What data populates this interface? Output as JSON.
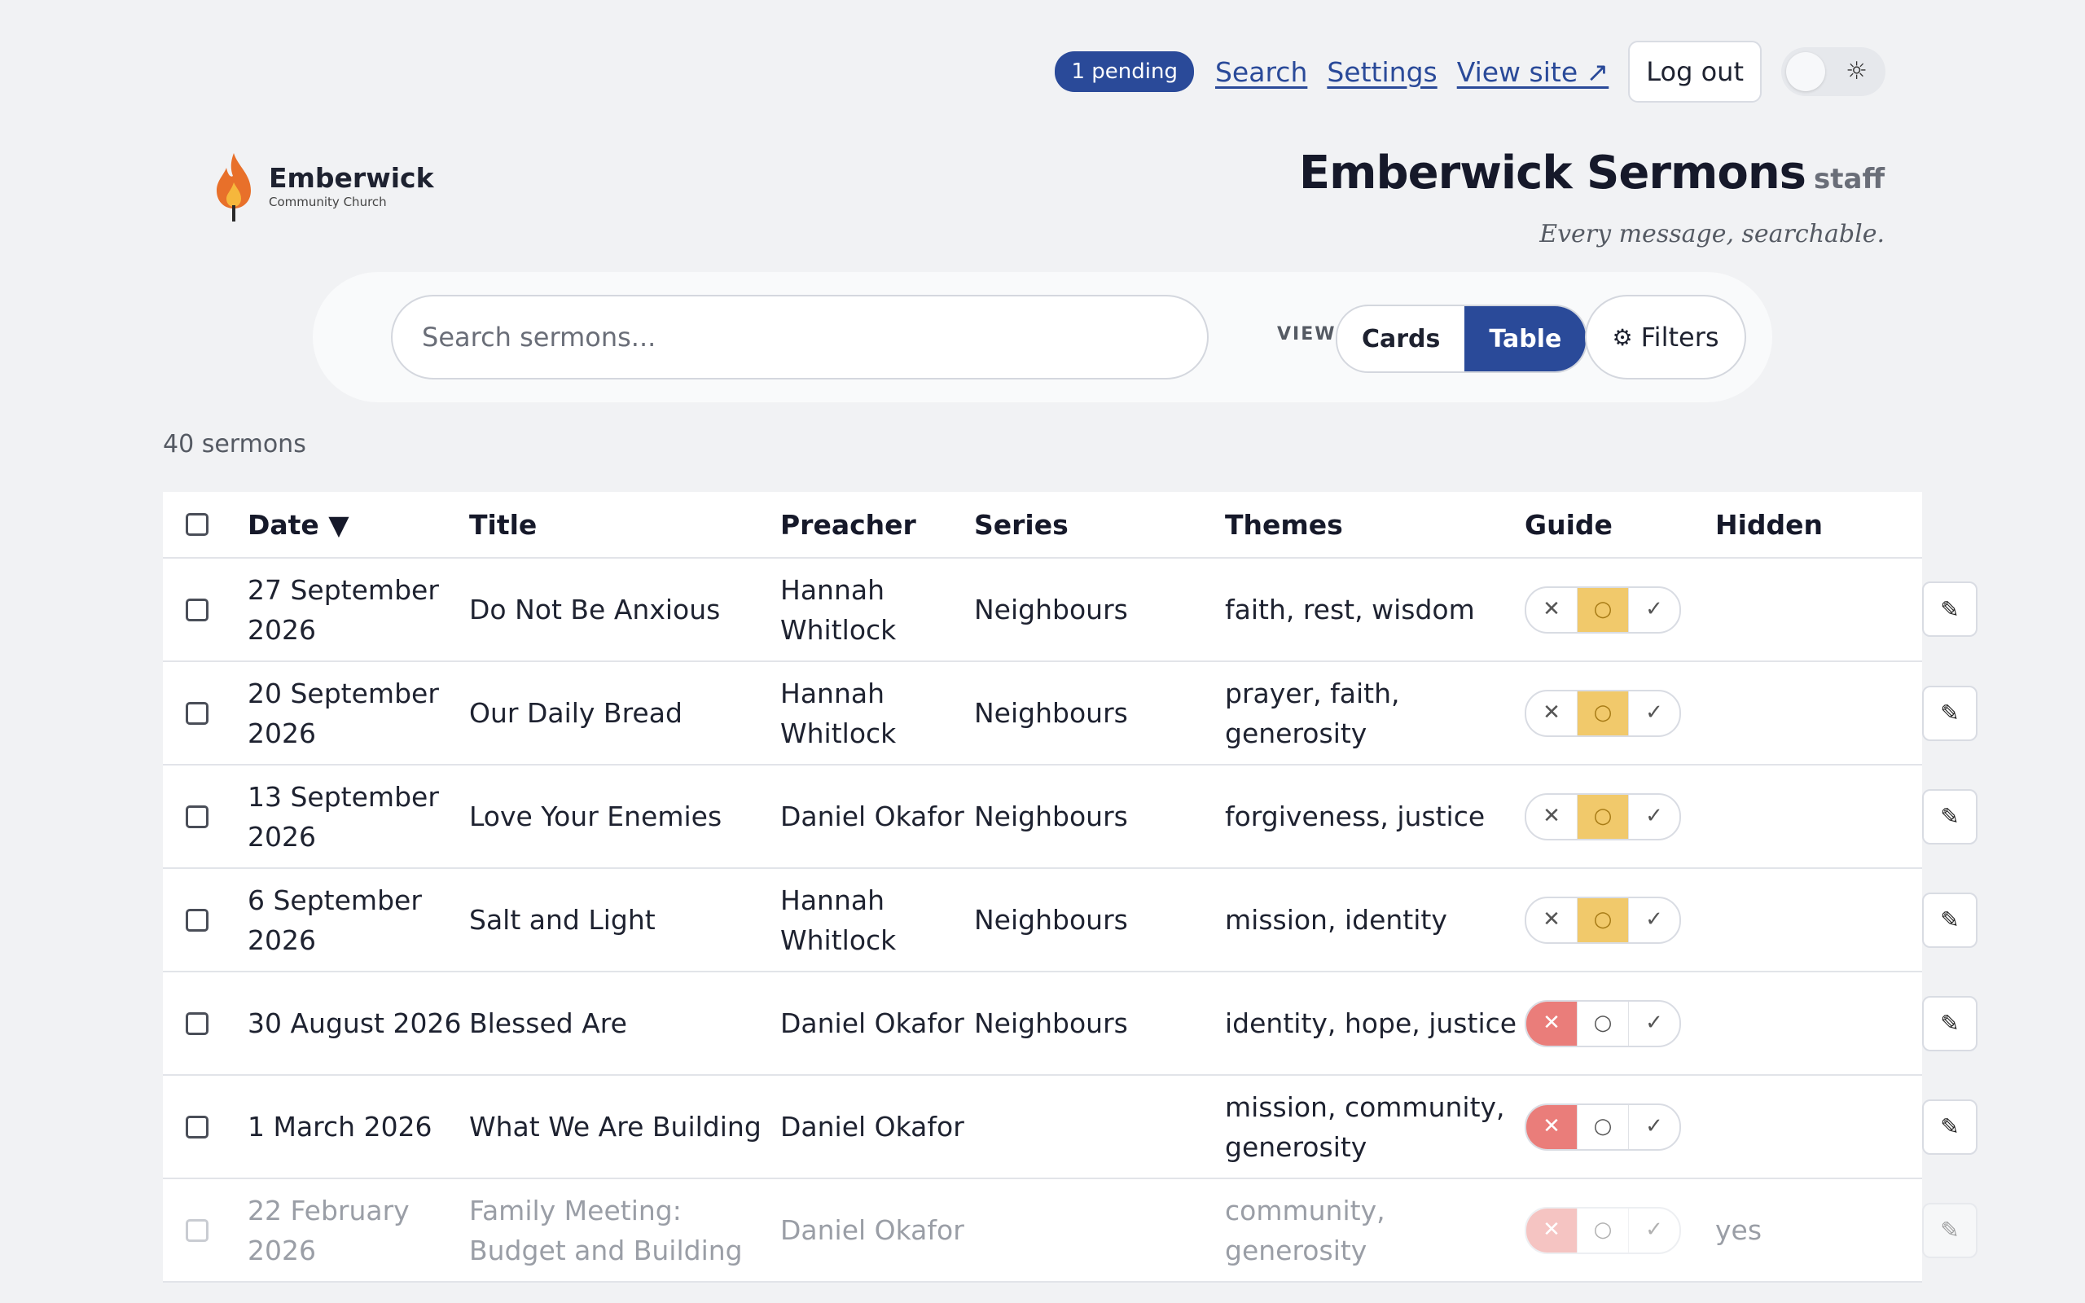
{
  "nav": {
    "pending": "1 pending",
    "search": "Search",
    "settings": "Settings",
    "view_site": "View site ↗",
    "logout": "Log out",
    "theme_icon": "sun-icon"
  },
  "logo": {
    "name": "Emberwick",
    "sub": "Community Church"
  },
  "header": {
    "title": "Emberwick Sermons",
    "staff": "staff",
    "tagline": "Every message, searchable."
  },
  "search": {
    "placeholder": "Search sermons...",
    "view_label": "VIEW",
    "cards": "Cards",
    "table": "Table",
    "filters": "Filters"
  },
  "count": "40 sermons",
  "table": {
    "headers": [
      "Date ▼",
      "Title",
      "Preacher",
      "Series",
      "Themes",
      "Guide",
      "Hidden"
    ],
    "rows": [
      {
        "date": "27 September 2026",
        "title": "Do Not Be Anxious",
        "preacher": "Hannah Whitlock",
        "series": "Neighbours",
        "themes": "faith, rest, wisdom",
        "guide": "pending",
        "hidden": ""
      },
      {
        "date": "20 September 2026",
        "title": "Our Daily Bread",
        "preacher": "Hannah Whitlock",
        "series": "Neighbours",
        "themes": "prayer, faith, generosity",
        "guide": "pending",
        "hidden": ""
      },
      {
        "date": "13 September 2026",
        "title": "Love Your Enemies",
        "preacher": "Daniel Okafor",
        "series": "Neighbours",
        "themes": "forgiveness, justice",
        "guide": "pending",
        "hidden": ""
      },
      {
        "date": "6 September 2026",
        "title": "Salt and Light",
        "preacher": "Hannah Whitlock",
        "series": "Neighbours",
        "themes": "mission, identity",
        "guide": "pending",
        "hidden": ""
      },
      {
        "date": "30 August 2026",
        "title": "Blessed Are",
        "preacher": "Daniel Okafor",
        "series": "Neighbours",
        "themes": "identity, hope, justice",
        "guide": "reject",
        "hidden": ""
      },
      {
        "date": "1 March 2026",
        "title": "What We Are Building",
        "preacher": "Daniel Okafor",
        "series": "",
        "themes": "mission, community, generosity",
        "guide": "reject",
        "hidden": ""
      },
      {
        "date": "22 February 2026",
        "title": "Family Meeting: Budget and Building",
        "preacher": "Daniel Okafor",
        "series": "",
        "themes": "community, generosity",
        "guide": "reject",
        "hidden": "yes"
      }
    ]
  },
  "guide_symbols": {
    "reject": "✕",
    "pending": "○",
    "approve": "✓"
  },
  "edit_icon": "✎"
}
